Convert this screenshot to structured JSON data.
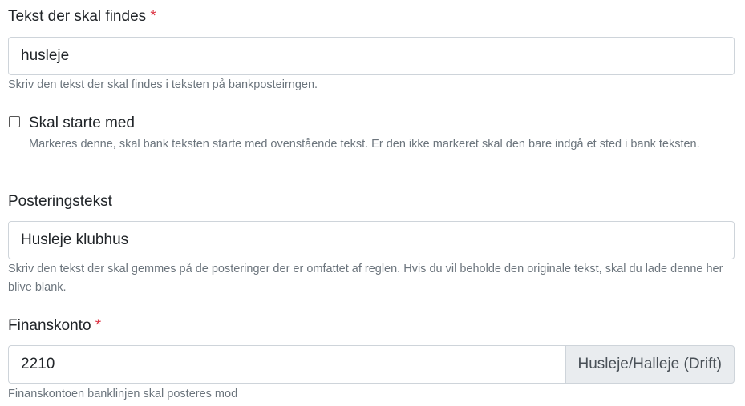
{
  "search_text": {
    "label": "Tekst der skal findes",
    "required_mark": "*",
    "value": "husleje",
    "help": "Skriv den tekst der skal findes i teksten på bankposteirngen."
  },
  "starts_with": {
    "label": "Skal starte med",
    "checked": false,
    "help": "Markeres denne, skal bank teksten starte med ovenstående tekst. Er den ikke markeret skal den bare indgå et sted i bank teksten."
  },
  "posting_text": {
    "label": "Posteringstekst",
    "value": "Husleje klubhus",
    "help": "Skriv den tekst der skal gemmes på de posteringer der er omfattet af reglen. Hvis du vil beholde den originale tekst, skal du lade denne her blive blank."
  },
  "finance_account": {
    "label": "Finanskonto",
    "required_mark": "*",
    "value": "2210",
    "account_name": "Husleje/Halleje (Drift)",
    "help": "Finanskontoen banklinjen skal posteres mod"
  },
  "colors": {
    "required": "#dc3545",
    "border": "#ced4da",
    "help_text": "#6c757d",
    "addon_bg": "#e9ecef"
  }
}
